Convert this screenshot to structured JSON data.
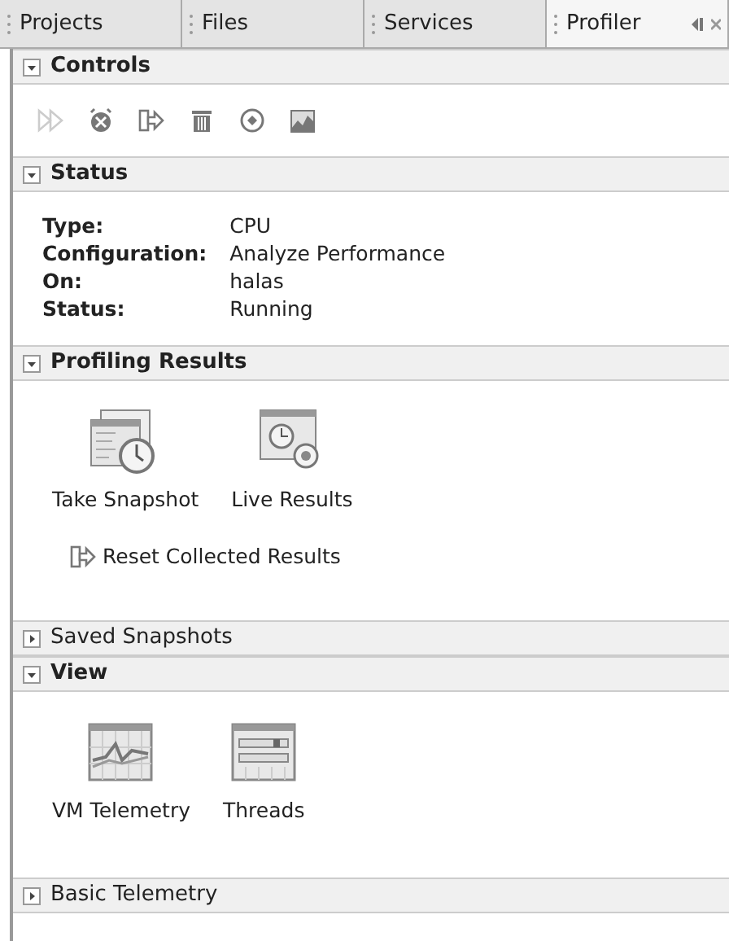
{
  "tabs": [
    {
      "label": "Projects",
      "selected": false
    },
    {
      "label": "Files",
      "selected": false
    },
    {
      "label": "Services",
      "selected": false
    },
    {
      "label": "Profiler",
      "selected": true
    }
  ],
  "sections": [
    {
      "title": "Controls",
      "expanded": true,
      "kind": "toolbar",
      "buttons": [
        {
          "kind": "rerun",
          "disabled": true
        },
        {
          "kind": "stop",
          "disabled": false
        },
        {
          "kind": "reset",
          "disabled": false
        },
        {
          "kind": "gc",
          "disabled": false
        },
        {
          "kind": "modify",
          "disabled": false
        },
        {
          "kind": "telemetry",
          "disabled": false
        }
      ]
    },
    {
      "title": "Status",
      "expanded": true,
      "kind": "properties",
      "rows": [
        {
          "label": "Type:",
          "value": "CPU"
        },
        {
          "label": "Configuration:",
          "value": "Analyze Performance"
        },
        {
          "label": "On:",
          "value": "halas"
        },
        {
          "label": "Status:",
          "value": "Running"
        }
      ]
    },
    {
      "title": "Profiling Results",
      "expanded": true,
      "kind": "launchers",
      "items": [
        {
          "label": "Take Snapshot",
          "kind": "snapshot"
        },
        {
          "label": "Live Results",
          "kind": "live"
        }
      ],
      "link": "Reset Collected Results"
    },
    {
      "title": "Saved Snapshots",
      "expanded": false
    },
    {
      "title": "View",
      "expanded": true,
      "kind": "launchers",
      "items": [
        {
          "label": "VM Telemetry",
          "kind": "telemetry"
        },
        {
          "label": "Threads",
          "kind": "threads"
        }
      ]
    },
    {
      "title": "Basic Telemetry",
      "expanded": false
    }
  ]
}
